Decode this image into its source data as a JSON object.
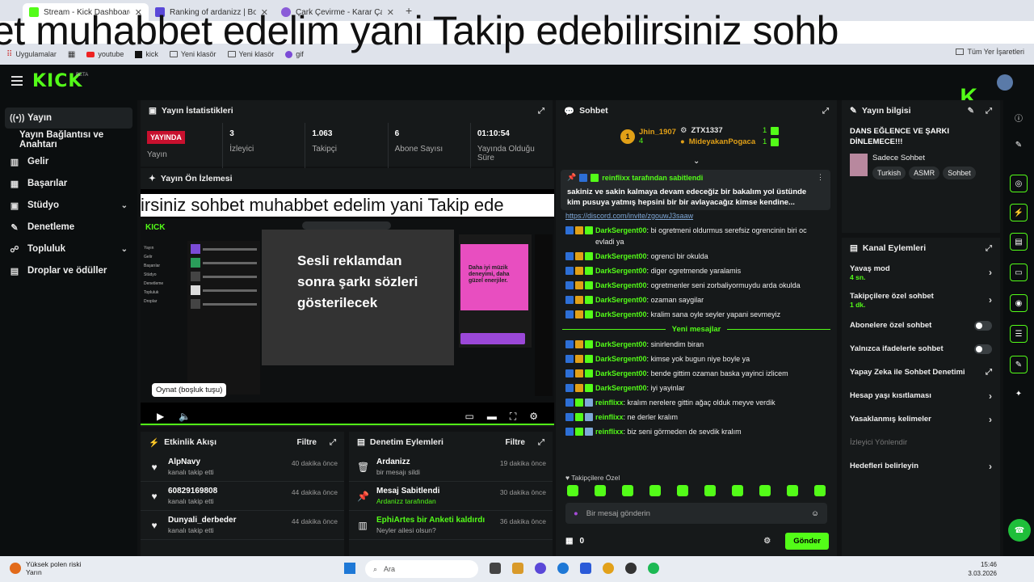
{
  "browser": {
    "tabs": [
      {
        "title": "Stream - Kick Dashboard",
        "color": "#53fc18"
      },
      {
        "title": "Ranking of ardanizz | BotRix",
        "color": "#5a48d8"
      },
      {
        "title": "Çark Çevirme - Karar Çarkı",
        "color": "#8a5cd8"
      }
    ],
    "bookmarks": [
      "Uygulamalar",
      "youtube",
      "kick",
      "Yeni klasör",
      "Yeni klasör",
      "gif"
    ],
    "all_bookmarks": "Tüm Yer İşaretleri"
  },
  "marquee_text": "et muhabbet edelim yani Takip edebilirsiniz sohb",
  "app": {
    "logo": "KICK",
    "beta": "BETA"
  },
  "sidebar": {
    "items": [
      {
        "label": "Yayın",
        "icon": "(•)"
      },
      {
        "label": "Yayın Bağlantısı ve Anahtarı",
        "icon": ""
      },
      {
        "label": "Gelir",
        "icon": "▥"
      },
      {
        "label": "Başarılar",
        "icon": "▦"
      },
      {
        "label": "Stüdyo",
        "icon": "▣"
      },
      {
        "label": "Denetleme",
        "icon": "✎"
      },
      {
        "label": "Topluluk",
        "icon": "☍"
      },
      {
        "label": "Droplar ve ödüller",
        "icon": "▤"
      }
    ]
  },
  "stats": {
    "title": "Yayın İstatistikleri",
    "live_badge": "YAYINDA",
    "items": [
      {
        "value": "",
        "label": "Yayın"
      },
      {
        "value": "3",
        "label": "İzleyici"
      },
      {
        "value": "1.063",
        "label": "Takipçi"
      },
      {
        "value": "6",
        "label": "Abone Sayısı"
      },
      {
        "value": "01:10:54",
        "label": "Yayında Olduğu Süre"
      }
    ]
  },
  "preview": {
    "title": "Yayın Ön İzlemesi",
    "marquee": "irsiniz sohbet muhabbet edelim yani Takip ede",
    "lyrics_overlay": "Sesli reklamdan sonra şarkı sözleri gösterilecek",
    "ad_text": "Daha iyi müzik deneyimi, daha güzel enerjiler.",
    "tooltip": "Oynat (boşluk tuşu)"
  },
  "activity": {
    "title": "Etkinlik Akışı",
    "filter": "Filtre",
    "items": [
      {
        "name": "AlpNavy",
        "sub": "kanalı takip etti",
        "time": "40 dakika önce"
      },
      {
        "name": "60829169808",
        "sub": "kanalı takip etti",
        "time": "44 dakika önce"
      },
      {
        "name": "Dunyali_derbeder",
        "sub": "kanalı takip etti",
        "time": "44 dakika önce"
      }
    ]
  },
  "moderation": {
    "title": "Denetim Eylemleri",
    "filter": "Filtre",
    "items": [
      {
        "name": "Ardanizz",
        "sub": "bir mesajı sildi",
        "time": "19 dakika önce",
        "icon": "🗑"
      },
      {
        "name": "Mesaj Sabitlendi",
        "sub": "Ardanizz tarafından",
        "time": "30 dakika önce",
        "icon": "📌"
      },
      {
        "name": "EphiArtes bir Anketi kaldırdı",
        "sub": "Neyler ailesi olsun?",
        "time": "36 dakika önce",
        "icon": "▥"
      }
    ]
  },
  "chat": {
    "title": "Sohbet",
    "leaderboard": [
      {
        "rank": "1",
        "name": "Jhin_1907",
        "count": "4"
      },
      {
        "rank": "",
        "name": "ZTX1337",
        "count": "1"
      },
      {
        "rank": "",
        "name": "MideyakanPogaca",
        "count": "1"
      }
    ],
    "pinned": {
      "header": "reinflixx tarafından sabitlendi",
      "body": "sakiniz ve sakin kalmaya devam edeceğiz bir bakalım yol üstünde kim pusuya yatmış hepsini bir bir avlayacağız kimse kendine..."
    },
    "link_line": "https://discord.com/invite/zgouwJ3saaw",
    "messages_before": [
      {
        "user": "DarkSergent00",
        "text": "bi ogretmeni oldurmus serefsiz ogrencinin biri oc evladi ya",
        "badges": "mvs"
      },
      {
        "user": "DarkSergent00",
        "text": "ogrenci bir okulda",
        "badges": "mvs"
      },
      {
        "user": "DarkSergent00",
        "text": "diger ogretmende yaralamis",
        "badges": "mvs"
      },
      {
        "user": "DarkSergent00",
        "text": "ogretmenler seni zorbaliyormuydu arda okulda",
        "badges": "mvs"
      },
      {
        "user": "DarkSergent00",
        "text": "ozaman saygilar",
        "badges": "mvs"
      },
      {
        "user": "DarkSergent00",
        "text": "kralim sana oyle seyler yapani sevmeyiz",
        "badges": "mvs"
      }
    ],
    "new_messages_label": "Yeni mesajlar",
    "messages_after": [
      {
        "user": "DarkSergent00",
        "text": "sinirlendim biran",
        "badges": "mvs"
      },
      {
        "user": "DarkSergent00",
        "text": "kimse yok bugun niye boyle ya",
        "badges": "mvs"
      },
      {
        "user": "DarkSergent00",
        "text": "bende gittim ozaman baska yayinci izlicem",
        "badges": "mvs"
      },
      {
        "user": "DarkSergent00",
        "text": "iyi yayinlar",
        "badges": "mvs"
      },
      {
        "user": "reinflixx",
        "text": "kralım nerelere gittin ağaç olduk meyve verdik",
        "badges": "msl"
      },
      {
        "user": "reinflixx",
        "text": "ne derler kralım",
        "badges": "msl"
      },
      {
        "user": "reinflixx",
        "text": "biz seni görmeden de sevdik kralım",
        "badges": "msl"
      }
    ],
    "sub_only_label": "Takipçilere Özel",
    "input_placeholder": "Bir mesaj gönderin",
    "points": "0",
    "send": "Gönder"
  },
  "stream_info": {
    "title": "Yayın bilgisi",
    "stream_title": "DANS EĞLENCE VE ŞARKI DİNLEMECE!!!",
    "category": "Sadece Sohbet",
    "tags": [
      "Turkish",
      "ASMR",
      "Sohbet"
    ]
  },
  "channel_actions": {
    "title": "Kanal Eylemleri",
    "items": [
      {
        "label": "Yavaş mod",
        "sub": "4 sn.",
        "control": "chevron"
      },
      {
        "label": "Takipçilere özel sohbet",
        "sub": "1 dk.",
        "control": "chevron"
      },
      {
        "label": "Abonelere özel sohbet",
        "sub": "",
        "control": "toggle"
      },
      {
        "label": "Yalnızca ifadelerle sohbet",
        "sub": "",
        "control": "toggle"
      },
      {
        "label": "Yapay Zeka ile Sohbet Denetimi",
        "sub": "",
        "control": "external"
      },
      {
        "label": "Hesap yaşı kısıtlaması",
        "sub": "",
        "control": "chevron"
      },
      {
        "label": "Yasaklanmış kelimeler",
        "sub": "",
        "control": "chevron"
      },
      {
        "label": "İzleyici Yönlendir",
        "sub": "",
        "control": "none"
      },
      {
        "label": "Hedefleri belirleyin",
        "sub": "",
        "control": "chevron"
      }
    ]
  },
  "taskbar": {
    "weather_title": "Yüksek polen riski",
    "weather_sub": "Yarın",
    "search": "Ara",
    "time": "15:46",
    "date": "3.03.2026"
  },
  "colors": {
    "accent": "#53fc18",
    "live": "#c8102e",
    "panel": "#16191a"
  }
}
